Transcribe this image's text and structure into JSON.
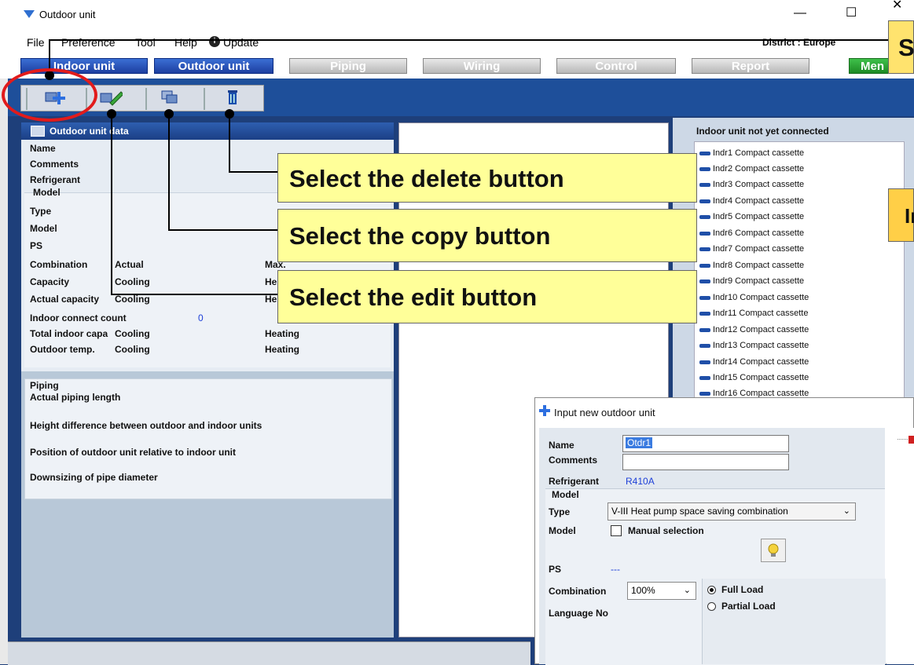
{
  "window": {
    "title": "Outdoor unit",
    "controls": [
      "—",
      "☐",
      "✕"
    ]
  },
  "menu": {
    "items": [
      "File",
      "Preference",
      "Tool",
      "Help",
      "Update"
    ],
    "district": "District : Europe"
  },
  "nav": {
    "tabs": [
      "Indoor unit",
      "Outdoor unit",
      "Piping",
      "Wiring",
      "Control",
      "Report",
      "Men"
    ]
  },
  "left_panel": {
    "header": "Outdoor unit data",
    "fields": [
      "Name",
      "Comments",
      "Refrigerant"
    ],
    "model_section": "Model",
    "model_fields": [
      "Type",
      "Model",
      "PS"
    ],
    "combination": {
      "label": "Combination",
      "col1": "Actual",
      "col2": "Max."
    },
    "capacity": {
      "label": "Capacity",
      "col1": "Cooling",
      "col2": "He"
    },
    "actual_capacity": {
      "label": "Actual capacity",
      "col1": "Cooling",
      "col2": "He"
    },
    "indoor_connect_count": {
      "label": "Indoor connect count",
      "value": "0"
    },
    "total_indoor_capa": {
      "label": "Total indoor capa",
      "col1": "Cooling",
      "col2": "Heating"
    },
    "outdoor_temp": {
      "label": "Outdoor temp.",
      "col1": "Cooling",
      "col2": "Heating"
    },
    "piping_section": "Piping",
    "piping_fields": [
      "Actual piping length",
      "Height difference between outdoor and indoor units",
      "Position of outdoor unit relative to indoor unit",
      "Downsizing of pipe diameter"
    ]
  },
  "right_panel": {
    "title": "Indoor unit not yet connected",
    "items": [
      "Indr1  Compact cassette",
      "Indr2  Compact cassette",
      "Indr3  Compact cassette",
      "Indr4  Compact cassette",
      "Indr5  Compact cassette",
      "Indr6  Compact cassette",
      "Indr7  Compact cassette",
      "Indr8  Compact cassette",
      "Indr9  Compact cassette",
      "Indr10  Compact cassette",
      "Indr11  Compact cassette",
      "Indr12  Compact cassette",
      "Indr13  Compact cassette",
      "Indr14  Compact cassette",
      "Indr15  Compact cassette",
      "Indr16  Compact cassette"
    ]
  },
  "callouts": {
    "delete": "Select the delete button",
    "copy": "Select  the copy button",
    "edit": "Select  the edit button",
    "top_right": "S",
    "mid_right": "In"
  },
  "dialog": {
    "title": "Input new outdoor unit",
    "name_label": "Name",
    "name_value": "Otdr1",
    "comments_label": "Comments",
    "comments_value": "",
    "refrigerant_label": "Refrigerant",
    "refrigerant_value": "R410A",
    "model_section": "Model",
    "type_label": "Type",
    "type_value": "V-III Heat pump space saving combination",
    "model_label": "Model",
    "manual_selection": "Manual selection",
    "manual_selection_checked": false,
    "ps_label": "PS",
    "ps_value": "---",
    "combination_label": "Combination",
    "combination_value": "100%",
    "full_load": "Full Load",
    "partial_load": "Partial Load",
    "selected_load": "Full Load",
    "language_label": "Language No"
  }
}
